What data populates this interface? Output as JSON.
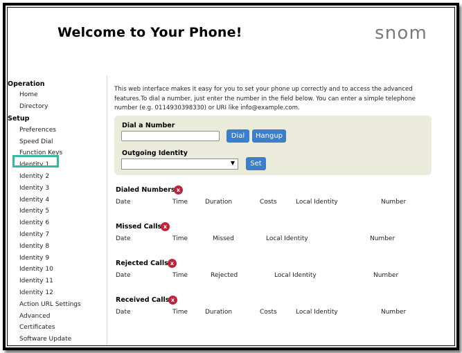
{
  "header": {
    "title": "Welcome to Your Phone!",
    "logo": "snom"
  },
  "sidebar": {
    "operation_label": "Operation",
    "operation_items": [
      "Home",
      "Directory"
    ],
    "setup_label": "Setup",
    "setup_items": [
      "Preferences",
      "Speed Dial",
      "Function Keys",
      "Identity 1",
      "Identity 2",
      "Identity 3",
      "Identity 4",
      "Identity 5",
      "Identity 6",
      "Identity 7",
      "Identity 8",
      "Identity 9",
      "Identity 10",
      "Identity 11",
      "Identity 12",
      "Action URL Settings",
      "Advanced",
      "Certificates",
      "Software Update"
    ],
    "selected": "Identity 1"
  },
  "intro": "This web interface makes it easy for you to set your phone up correctly and to access the advanced features.To dial a number, just enter the number in the field below. You can enter a simple telephone number (e.g. 0114930398330) or URI like info@example.com.",
  "dial": {
    "label": "Dial a Number",
    "value": "",
    "dial_button": "Dial",
    "hangup_button": "Hangup",
    "identity_label": "Outgoing Identity",
    "identity_value": "",
    "set_button": "Set"
  },
  "sections": {
    "dialed": {
      "title": "Dialed Numbers",
      "columns": [
        "Date",
        "Time",
        "Duration",
        "Costs",
        "Local Identity",
        "Number"
      ]
    },
    "missed": {
      "title": "Missed Calls",
      "columns": [
        "Date",
        "Time",
        "Missed",
        "Local Identity",
        "Number"
      ]
    },
    "rejected": {
      "title": "Rejected Calls",
      "columns": [
        "Date",
        "Time",
        "Rejected",
        "Local Identity",
        "Number"
      ]
    },
    "received": {
      "title": "Received Calls",
      "columns": [
        "Date",
        "Time",
        "Duration",
        "Costs",
        "Local Identity",
        "Number"
      ]
    }
  },
  "icons": {
    "clear": "x"
  },
  "colors": {
    "accent": "#3b7ecb",
    "highlight": "#38b8a3",
    "clear": "#c0243a",
    "panel": "#ebebdc"
  }
}
